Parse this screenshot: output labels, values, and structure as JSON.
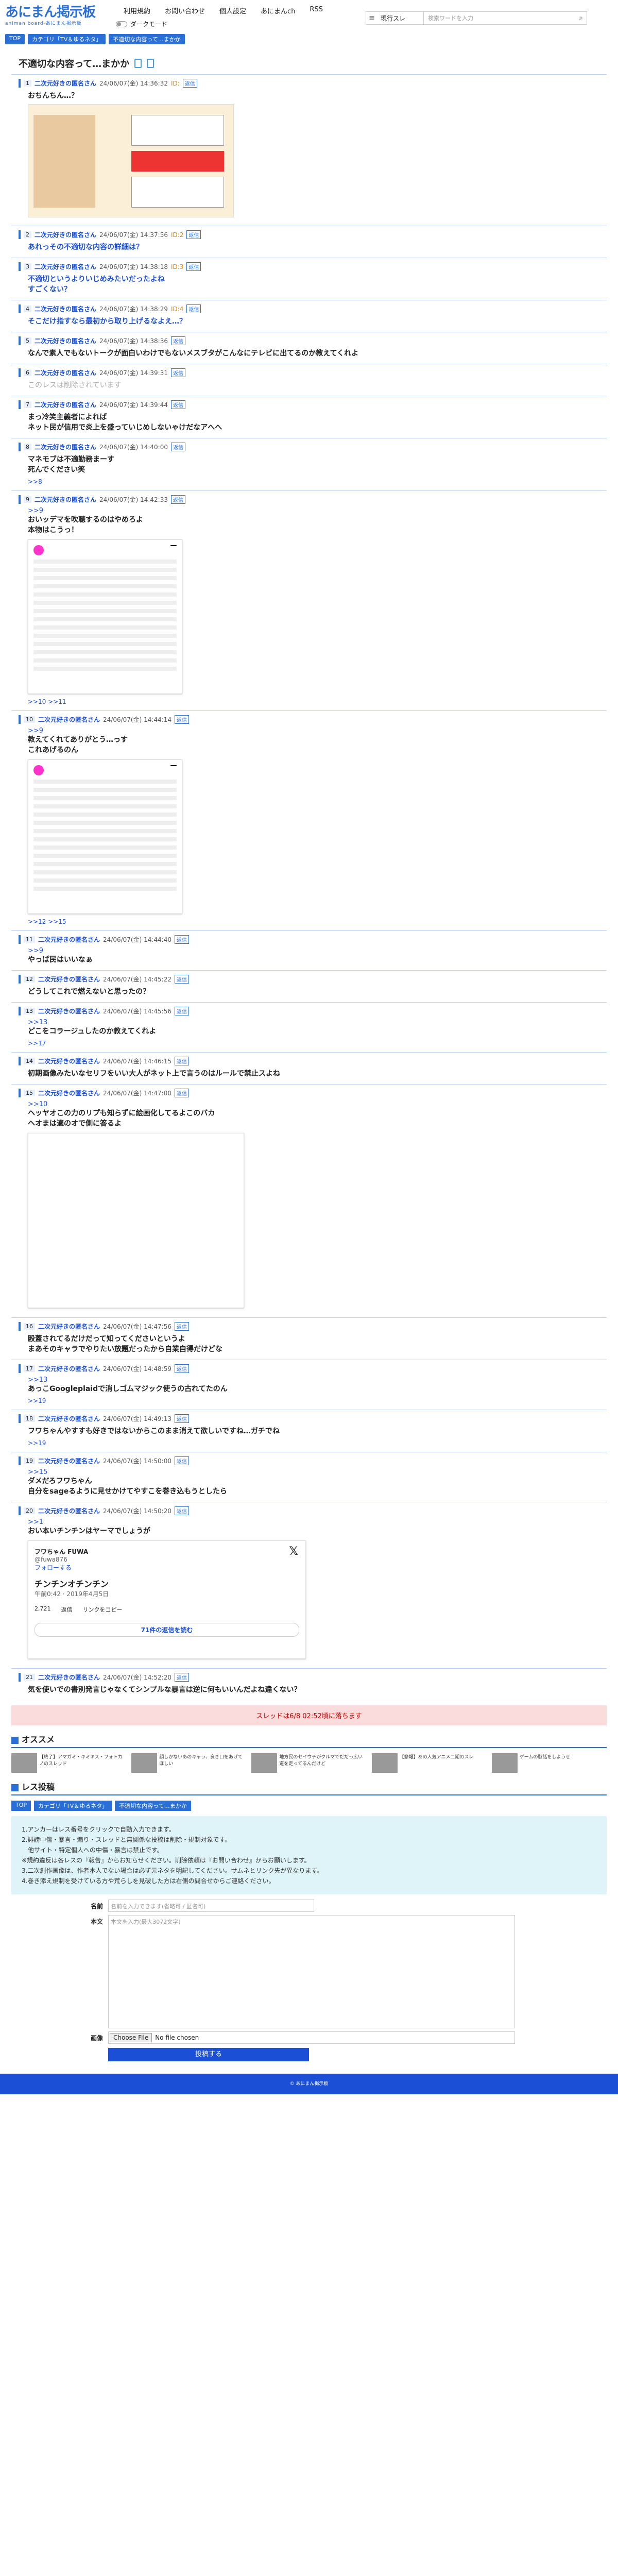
{
  "header": {
    "logo_text": "あにまん掲示板",
    "logo_sub": "animan board-あにまん掲示板",
    "nav": [
      "利用規約",
      "お問い合わせ",
      "個人設定",
      "あにまんch",
      "RSS"
    ],
    "dark_mode": "ダークモード",
    "search_select": "現行スレ",
    "search_placeholder": "検索ワードを入力"
  },
  "breadcrumb": [
    "TOP",
    "カテゴリ「TV＆ゆるネタ」",
    "不適切な内容って…まかか"
  ],
  "thread_title": "不適切な内容って…まかか",
  "posts": [
    {
      "no": "1",
      "name": "二次元好きの匿名さん",
      "date": "24/06/07(金) 14:36:32",
      "id": "ID:",
      "body": "おちんちん…？",
      "style": "",
      "media": "img1",
      "rel": ""
    },
    {
      "no": "2",
      "name": "二次元好きの匿名さん",
      "date": "24/06/07(金) 14:37:56",
      "id": "ID:2",
      "body": "あれっその不適切な内容の詳細は？",
      "style": "blue",
      "media": "",
      "rel": ""
    },
    {
      "no": "3",
      "name": "二次元好きの匿名さん",
      "date": "24/06/07(金) 14:38:18",
      "id": "ID:3",
      "body": "不適切というよりいじめみたいだったよね\nすごくない？",
      "style": "blue",
      "media": "",
      "rel": ""
    },
    {
      "no": "4",
      "name": "二次元好きの匿名さん",
      "date": "24/06/07(金) 14:38:29",
      "id": "ID:4",
      "body": "そこだけ指すなら最初から取り上げるなよえ…？",
      "style": "blue",
      "media": "",
      "rel": ""
    },
    {
      "no": "5",
      "name": "二次元好きの匿名さん",
      "date": "24/06/07(金) 14:38:36",
      "id": "",
      "body": "なんで素人でもないトークが面白いわけでもないメスブタがこんなにテレビに出てるのか教えてくれよ",
      "style": "",
      "media": "",
      "rel": ""
    },
    {
      "no": "6",
      "name": "二次元好きの匿名さん",
      "date": "24/06/07(金) 14:39:31",
      "id": "",
      "body": "このレスは削除されています",
      "style": "gray",
      "media": "",
      "rel": ""
    },
    {
      "no": "7",
      "name": "二次元好きの匿名さん",
      "date": "24/06/07(金) 14:39:44",
      "id": "",
      "body": "まっ冷笑主義者によれば\nネット民が信用で炎上を盛っていじめしないゃけだなアへへ",
      "style": "",
      "media": "",
      "rel": ""
    },
    {
      "no": "8",
      "name": "二次元好きの匿名さん",
      "date": "24/06/07(金) 14:40:00",
      "id": "",
      "body": "マネモブは不適勤務まーす\n死んでください笑",
      "style": "",
      "media": "",
      "rel": ">>8"
    },
    {
      "no": "9",
      "name": "二次元好きの匿名さん",
      "date": "24/06/07(金) 14:42:33",
      "id": "",
      "anchor": ">>9",
      "body": "おいッデマを吹聴するのはやめろよ\n本物はこうっ！",
      "style": "",
      "media": "tw",
      "rel": ">>10 >>11"
    },
    {
      "no": "10",
      "name": "二次元好きの匿名さん",
      "date": "24/06/07(金) 14:44:14",
      "id": "",
      "anchor": ">>9",
      "body": "教えてくれてありがとう…っす\nこれあげるのん",
      "style": "",
      "media": "tw",
      "rel": ">>12 >>15"
    },
    {
      "no": "11",
      "name": "二次元好きの匿名さん",
      "date": "24/06/07(金) 14:44:40",
      "id": "",
      "anchor": ">>9",
      "body": "やっぱ民はいいなぁ",
      "style": "",
      "media": "",
      "rel": ""
    },
    {
      "no": "12",
      "name": "二次元好きの匿名さん",
      "date": "24/06/07(金) 14:45:22",
      "id": "",
      "body": "どうしてこれで燃えないと思ったの？",
      "style": "",
      "media": "",
      "rel": ""
    },
    {
      "no": "13",
      "name": "二次元好きの匿名さん",
      "date": "24/06/07(金) 14:45:56",
      "id": "",
      "anchor": ">>13",
      "body": "どこをコラージュしたのか教えてくれよ",
      "style": "",
      "media": "",
      "rel": ">>17"
    },
    {
      "no": "14",
      "name": "二次元好きの匿名さん",
      "date": "24/06/07(金) 14:46:15",
      "id": "",
      "body": "初期画像みたいなセリフをいい大人がネット上で言うのはルールで禁止スよね",
      "style": "",
      "media": "",
      "rel": ""
    },
    {
      "no": "15",
      "name": "二次元好きの匿名さん",
      "date": "24/06/07(金) 14:47:00",
      "id": "",
      "anchor": ">>10",
      "body": "ヘッヤオこの力のリプも知らずに絵画化してるよこのバカ\nヘオまは適のオで側に答るよ",
      "style": "",
      "media": "tw2",
      "rel": ""
    },
    {
      "no": "16",
      "name": "二次元好きの匿名さん",
      "date": "24/06/07(金) 14:47:56",
      "id": "",
      "body": "殴蓋されてるだけだって知ってくださいというよ\nまあそのキャラでやりたい放題だったから自業自得だけどな",
      "style": "",
      "media": "",
      "rel": ""
    },
    {
      "no": "17",
      "name": "二次元好きの匿名さん",
      "date": "24/06/07(金) 14:48:59",
      "id": "",
      "anchor": ">>13",
      "body": "あっこGoogleplaidで消しゴムマジック使うの古れてたのん",
      "style": "",
      "media": "",
      "rel": ">>19"
    },
    {
      "no": "18",
      "name": "二次元好きの匿名さん",
      "date": "24/06/07(金) 14:49:13",
      "id": "",
      "body": "フワちゃんやすすも好きではないからこのまま消えて欲しいですね…ガチでね",
      "style": "",
      "media": "",
      "rel": ">>19"
    },
    {
      "no": "19",
      "name": "二次元好きの匿名さん",
      "date": "24/06/07(金) 14:50:00",
      "id": "",
      "anchor": ">>15",
      "body": "ダメだろフワちゃん\n自分をsageるように見せかけてやすこを巻き込もうとしたら",
      "style": "",
      "media": "",
      "rel": ""
    },
    {
      "no": "20",
      "name": "二次元好きの匿名さん",
      "date": "24/06/07(金) 14:50:20",
      "id": "",
      "anchor": ">>1",
      "body": "おい本いチンチンはヤーマでしょうが",
      "style": "",
      "media": "tw3",
      "rel": ""
    },
    {
      "no": "21",
      "name": "二次元好きの匿名さん",
      "date": "24/06/07(金) 14:52:20",
      "id": "",
      "body": "気を使いでの書別発言じゃなくてシンプルな暴言は逆に何もいいんだよね違くない？",
      "style": "",
      "media": "",
      "rel": ""
    }
  ],
  "reply_label": "返信",
  "tweet": {
    "name": "フワちゃん FUWA",
    "handle": "@fuwa876",
    "follow": "フォローする",
    "text": "チンチンオチンチン",
    "time": "午前0:42 · 2019年4月5日",
    "likes": "2,721",
    "reply": "返信",
    "copy": "リンクをコピー",
    "more": "71件の返信を読む"
  },
  "warning": "スレッドは6/8 02:52頃に落ちます",
  "recommend_title": "オススメ",
  "recommend": [
    "【終了】アマガミ・キミキス・フォトカノのスレッド",
    "顔しかないあのキャラ、良き口をあげてほしい",
    "地方民のセイウチがクルマでだだっ広い道を走ってるんだけど",
    "【悲報】あの人気アニメ二期のスレ",
    "ゲームの駄話をしようぜ"
  ],
  "form": {
    "title": "レス投稿",
    "notes": [
      "1.アンカーはレス番号をクリックで自動入力できます。",
      "2.誹謗中傷・暴言・煽り・スレッドと無関係な投稿は削除・規制対象です。",
      "　他サイト・特定個人への中傷・暴言は禁止です。",
      "※規約違反は各レスの『報告』からお知らせください。削除依頼は『お問い合わせ』からお願いします。",
      "3.二次創作画像は、作者本人でない場合は必ず元ネタを明記してください。サムネとリンク先が異なります。",
      "4.巻き添え規制を受けている方や荒らしを見破した方は右側の問合せからご連絡ください。"
    ],
    "name_label": "名前",
    "name_placeholder": "名前を入力できます(省略可 / 匿名可)",
    "body_label": "本文",
    "body_placeholder": "本文を入力(最大3072文字)",
    "image_label": "画像",
    "file_button": "Choose File",
    "file_text": "No file chosen",
    "submit": "投稿する"
  },
  "footer": "© あにまん掲示板"
}
